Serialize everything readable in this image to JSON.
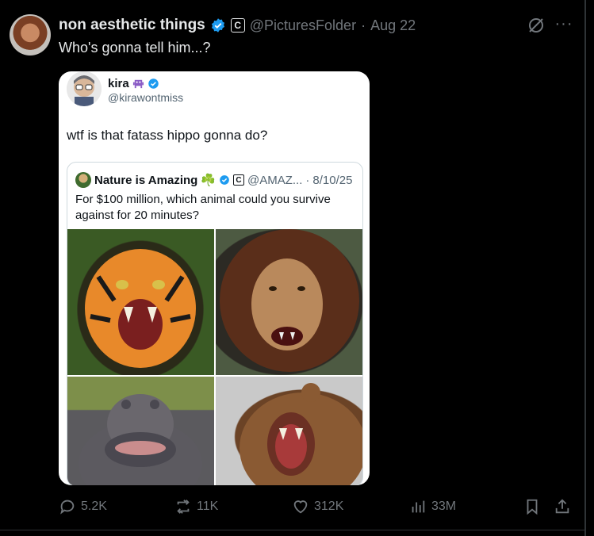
{
  "tweet": {
    "author_name": "non aesthetic things",
    "badge_letter": "C",
    "handle": "@PicturesFolder",
    "separator": "·",
    "date": "Aug 22",
    "text": "Who's gonna tell him...?",
    "more_glyph": "···"
  },
  "quoted_card": {
    "author_name": "kira",
    "handle": "@kirawontmiss",
    "text": "wtf is that fatass hippo gonna do?",
    "inner_quote": {
      "author_name": "Nature is Amazing",
      "clover": "☘️",
      "badge_letter": "C",
      "handle": "@AMAZ...",
      "separator": "·",
      "date": "8/10/25",
      "text": "For $100 million, which animal could you survive against for 20 minutes?",
      "images": [
        "tiger",
        "lion",
        "hippo",
        "bear"
      ]
    }
  },
  "actions": {
    "replies": "5.2K",
    "reposts": "11K",
    "likes": "312K",
    "views": "33M"
  },
  "colors": {
    "background": "#000000",
    "primary_text": "#e7e9ea",
    "secondary_text": "#71767b",
    "verified_blue": "#1d9bf0"
  },
  "icons": {
    "grok": "grok-icon",
    "reply": "reply-icon",
    "repost": "repost-icon",
    "like": "heart-icon",
    "views": "analytics-icon",
    "bookmark": "bookmark-icon",
    "share": "share-icon"
  }
}
